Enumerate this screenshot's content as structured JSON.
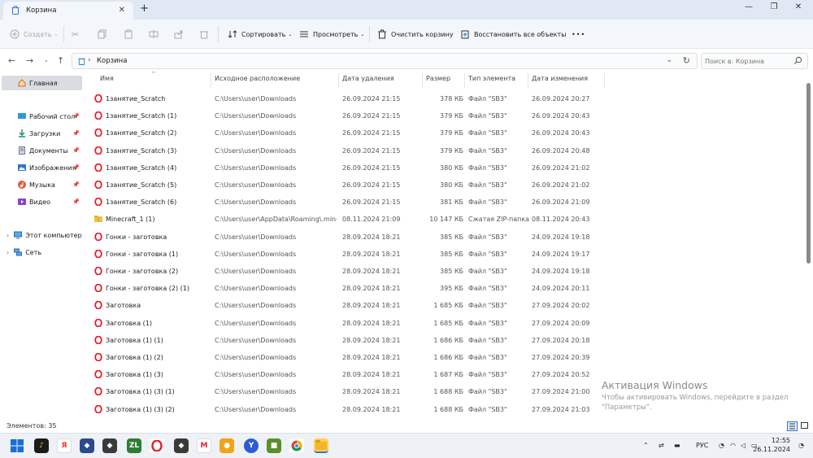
{
  "window": {
    "tab_title": "Корзина",
    "tab_add": "+",
    "controls": {
      "minimize": "—",
      "maximize": "❐",
      "close": "✕"
    }
  },
  "toolbar": {
    "create": "Создать",
    "sort": "Сортировать",
    "view": "Просмотреть",
    "empty_bin": "Очистить корзину",
    "restore_all": "Восстановить все объекты",
    "more": "•••"
  },
  "address": {
    "path": "Корзина",
    "search_placeholder": "Поиск в: Корзина"
  },
  "sidebar": {
    "home": "Главная",
    "pinned": [
      {
        "label": "Рабочий стол",
        "icon": "desktop-icon"
      },
      {
        "label": "Загрузки",
        "icon": "download-icon"
      },
      {
        "label": "Документы",
        "icon": "documents-icon"
      },
      {
        "label": "Изображения",
        "icon": "pictures-icon"
      },
      {
        "label": "Музыка",
        "icon": "music-icon"
      },
      {
        "label": "Видео",
        "icon": "video-icon"
      }
    ],
    "this_pc": "Этот компьютер",
    "network": "Сеть"
  },
  "columns": {
    "name": "Имя",
    "location": "Исходное расположение",
    "deleted": "Дата удаления",
    "size": "Размер",
    "type": "Тип элемента",
    "modified": "Дата изменения"
  },
  "files": [
    {
      "name": "1занятие_Scratch",
      "loc": "C:\\Users\\user\\Downloads",
      "deleted": "26.09.2024 21:15",
      "size": "378 КБ",
      "type": "Файл \"SB3\"",
      "modified": "26.09.2024 20:27",
      "icon": "opera"
    },
    {
      "name": "1занятие_Scratch (1)",
      "loc": "C:\\Users\\user\\Downloads",
      "deleted": "26.09.2024 21:15",
      "size": "379 КБ",
      "type": "Файл \"SB3\"",
      "modified": "26.09.2024 20:43",
      "icon": "opera"
    },
    {
      "name": "1занятие_Scratch (2)",
      "loc": "C:\\Users\\user\\Downloads",
      "deleted": "26.09.2024 21:15",
      "size": "379 КБ",
      "type": "Файл \"SB3\"",
      "modified": "26.09.2024 20:43",
      "icon": "opera"
    },
    {
      "name": "1занятие_Scratch (3)",
      "loc": "C:\\Users\\user\\Downloads",
      "deleted": "26.09.2024 21:15",
      "size": "379 КБ",
      "type": "Файл \"SB3\"",
      "modified": "26.09.2024 20:48",
      "icon": "opera"
    },
    {
      "name": "1занятие_Scratch (4)",
      "loc": "C:\\Users\\user\\Downloads",
      "deleted": "26.09.2024 21:15",
      "size": "380 КБ",
      "type": "Файл \"SB3\"",
      "modified": "26.09.2024 21:02",
      "icon": "opera"
    },
    {
      "name": "1занятие_Scratch (5)",
      "loc": "C:\\Users\\user\\Downloads",
      "deleted": "26.09.2024 21:15",
      "size": "380 КБ",
      "type": "Файл \"SB3\"",
      "modified": "26.09.2024 21:02",
      "icon": "opera"
    },
    {
      "name": "1занятие_Scratch (6)",
      "loc": "C:\\Users\\user\\Downloads",
      "deleted": "26.09.2024 21:15",
      "size": "381 КБ",
      "type": "Файл \"SB3\"",
      "modified": "26.09.2024 21:09",
      "icon": "opera"
    },
    {
      "name": "Minecraft_1 (1)",
      "loc": "C:\\Users\\user\\AppData\\Roaming\\.minecr...",
      "deleted": "08.11.2024 21:09",
      "size": "10 147 КБ",
      "type": "Сжатая ZIP-папка",
      "modified": "08.11.2024 20:43",
      "icon": "zip"
    },
    {
      "name": "Гонки - заготовка",
      "loc": "C:\\Users\\user\\Downloads",
      "deleted": "28.09.2024 18:21",
      "size": "385 КБ",
      "type": "Файл \"SB3\"",
      "modified": "24.09.2024 19:18",
      "icon": "opera"
    },
    {
      "name": "Гонки - заготовка (1)",
      "loc": "C:\\Users\\user\\Downloads",
      "deleted": "28.09.2024 18:21",
      "size": "385 КБ",
      "type": "Файл \"SB3\"",
      "modified": "24.09.2024 19:17",
      "icon": "opera"
    },
    {
      "name": "Гонки - заготовка (2)",
      "loc": "C:\\Users\\user\\Downloads",
      "deleted": "28.09.2024 18:21",
      "size": "385 КБ",
      "type": "Файл \"SB3\"",
      "modified": "24.09.2024 19:18",
      "icon": "opera"
    },
    {
      "name": "Гонки - заготовка (2) (1)",
      "loc": "C:\\Users\\user\\Downloads",
      "deleted": "28.09.2024 18:21",
      "size": "395 КБ",
      "type": "Файл \"SB3\"",
      "modified": "24.09.2024 20:11",
      "icon": "opera"
    },
    {
      "name": "Заготовка",
      "loc": "C:\\Users\\user\\Downloads",
      "deleted": "28.09.2024 18:21",
      "size": "1 685 КБ",
      "type": "Файл \"SB3\"",
      "modified": "27.09.2024 20:02",
      "icon": "opera"
    },
    {
      "name": "Заготовка (1)",
      "loc": "C:\\Users\\user\\Downloads",
      "deleted": "28.09.2024 18:21",
      "size": "1 685 КБ",
      "type": "Файл \"SB3\"",
      "modified": "27.09.2024 20:09",
      "icon": "opera"
    },
    {
      "name": "Заготовка (1) (1)",
      "loc": "C:\\Users\\user\\Downloads",
      "deleted": "28.09.2024 18:21",
      "size": "1 686 КБ",
      "type": "Файл \"SB3\"",
      "modified": "27.09.2024 20:18",
      "icon": "opera"
    },
    {
      "name": "Заготовка (1) (2)",
      "loc": "C:\\Users\\user\\Downloads",
      "deleted": "28.09.2024 18:21",
      "size": "1 686 КБ",
      "type": "Файл \"SB3\"",
      "modified": "27.09.2024 20:39",
      "icon": "opera"
    },
    {
      "name": "Заготовка (1) (3)",
      "loc": "C:\\Users\\user\\Downloads",
      "deleted": "28.09.2024 18:21",
      "size": "1 687 КБ",
      "type": "Файл \"SB3\"",
      "modified": "27.09.2024 20:52",
      "icon": "opera"
    },
    {
      "name": "Заготовка (1) (3) (1)",
      "loc": "C:\\Users\\user\\Downloads",
      "deleted": "28.09.2024 18:21",
      "size": "1 688 КБ",
      "type": "Файл \"SB3\"",
      "modified": "27.09.2024 21:00",
      "icon": "opera"
    },
    {
      "name": "Заготовка (1) (3) (2)",
      "loc": "C:\\Users\\user\\Downloads",
      "deleted": "28.09.2024 18:21",
      "size": "1 688 КБ",
      "type": "Файл \"SB3\"",
      "modified": "27.09.2024 21:03",
      "icon": "opera"
    }
  ],
  "status": {
    "count": "Элементов: 35"
  },
  "watermark": {
    "title": "Активация Windows",
    "subtitle": "Чтобы активировать Windows, перейдите в раздел \"Параметры\"."
  },
  "taskbar": {
    "apps": [
      "start-icon",
      "yandex-music-icon",
      "yandex-browser-icon",
      "vpn-shield-icon",
      "shield-app-icon",
      "zl-app-icon",
      "opera-icon",
      "steam-like-icon",
      "m-app-icon",
      "game-icon",
      "y-app-icon",
      "minecraft-icon",
      "chrome-icon",
      "file-explorer-icon"
    ],
    "lang": "РУС",
    "time": "12:55",
    "date": "26.11.2024"
  },
  "colors": {
    "opera_red": "#e0202c",
    "folder_yellow": "#f2c33c",
    "accent_blue": "#2b78d4"
  }
}
